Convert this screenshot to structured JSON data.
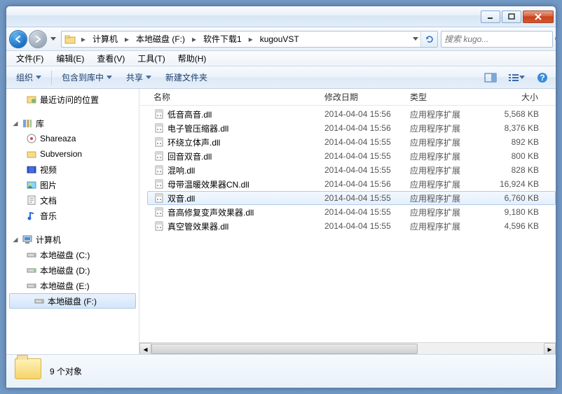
{
  "breadcrumbs": [
    "计算机",
    "本地磁盘 (F:)",
    "软件下载1",
    "kugouVST"
  ],
  "search_placeholder": "搜索 kugo...",
  "menus": [
    {
      "label": "文件",
      "accel": "(F)"
    },
    {
      "label": "编辑",
      "accel": "(E)"
    },
    {
      "label": "查看",
      "accel": "(V)"
    },
    {
      "label": "工具",
      "accel": "(T)"
    },
    {
      "label": "帮助",
      "accel": "(H)"
    }
  ],
  "toolbar": {
    "organize": "组织",
    "include": "包含到库中",
    "share": "共享",
    "newfolder": "新建文件夹"
  },
  "sidebar": {
    "recent": "最近访问的位置",
    "library": "库",
    "lib_items": [
      "Shareaza",
      "Subversion",
      "视频",
      "图片",
      "文档",
      "音乐"
    ],
    "computer": "计算机",
    "drives": [
      "本地磁盘 (C:)",
      "本地磁盘 (D:)",
      "本地磁盘 (E:)",
      "本地磁盘 (F:)"
    ]
  },
  "columns": {
    "name": "名称",
    "date": "修改日期",
    "type": "类型",
    "size": "大小"
  },
  "files": [
    {
      "name": "低音高音.dll",
      "date": "2014-04-04 15:56",
      "type": "应用程序扩展",
      "size": "5,568 KB"
    },
    {
      "name": "电子管压缩器.dll",
      "date": "2014-04-04 15:56",
      "type": "应用程序扩展",
      "size": "8,376 KB"
    },
    {
      "name": "环绕立体声.dll",
      "date": "2014-04-04 15:55",
      "type": "应用程序扩展",
      "size": "892 KB"
    },
    {
      "name": "回音双音.dll",
      "date": "2014-04-04 15:55",
      "type": "应用程序扩展",
      "size": "800 KB"
    },
    {
      "name": "混响.dll",
      "date": "2014-04-04 15:55",
      "type": "应用程序扩展",
      "size": "828 KB"
    },
    {
      "name": "母带温暖效果器CN.dll",
      "date": "2014-04-04 15:56",
      "type": "应用程序扩展",
      "size": "16,924 KB"
    },
    {
      "name": "双音.dll",
      "date": "2014-04-04 15:55",
      "type": "应用程序扩展",
      "size": "6,760 KB",
      "selected": true
    },
    {
      "name": "音高修复变声效果器.dll",
      "date": "2014-04-04 15:55",
      "type": "应用程序扩展",
      "size": "9,180 KB"
    },
    {
      "name": "真空管效果器.dll",
      "date": "2014-04-04 15:55",
      "type": "应用程序扩展",
      "size": "4,596 KB"
    }
  ],
  "status": "9 个对象"
}
